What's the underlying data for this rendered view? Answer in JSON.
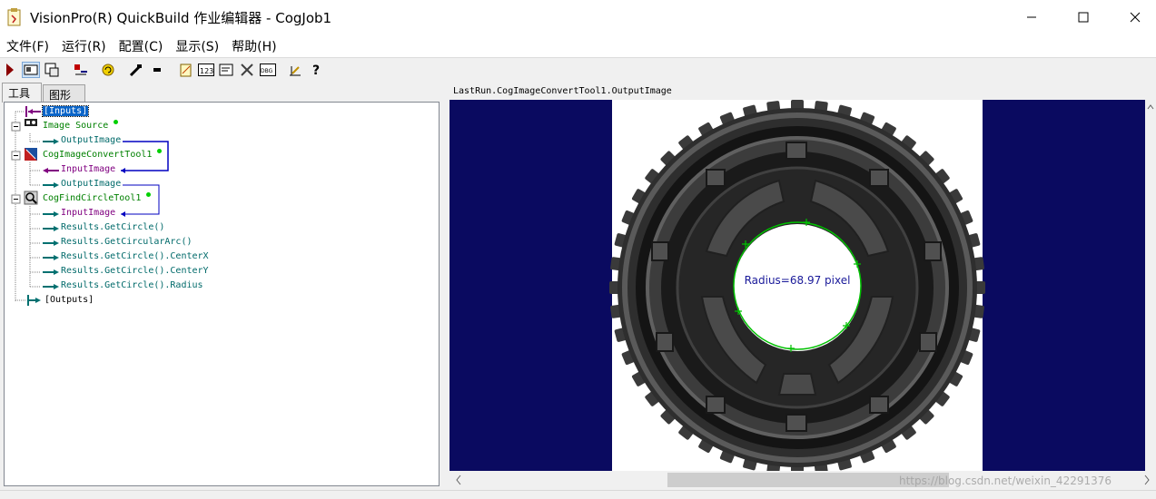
{
  "window": {
    "title": "VisionPro(R) QuickBuild 作业编辑器 - CogJob1",
    "minimize_icon": "minimize-icon",
    "maximize_icon": "maximize-icon",
    "close_icon": "close-icon"
  },
  "menu": {
    "items": [
      "文件(F)",
      "运行(R)",
      "配置(C)",
      "显示(S)",
      "帮助(H)"
    ]
  },
  "toolbar": {
    "icons": [
      "run-icon",
      "image-view-icon",
      "save-icon",
      "add-input-icon",
      "refresh-icon",
      "tool-icon",
      "small-tool-icon",
      "edit-icon",
      "number-icon",
      "display-icon",
      "tools-icon",
      "debug-icon",
      "measure-icon",
      "help-icon"
    ]
  },
  "left_panel": {
    "tabs": [
      "工具",
      "图形"
    ],
    "tree": {
      "inputs": "[Inputs]",
      "image_source": "Image Source",
      "image_source_output": "OutputImage",
      "convert_tool": "CogImageConvertTool1",
      "convert_input": "InputImage",
      "convert_output": "OutputImage",
      "find_circle_tool": "CogFindCircleTool1",
      "find_circle_input": "InputImage",
      "results": [
        "Results.GetCircle()",
        "Results.GetCircularArc()",
        "Results.GetCircle().CenterX",
        "Results.GetCircle().CenterY",
        "Results.GetCircle().Radius"
      ],
      "outputs": "[Outputs]"
    }
  },
  "image_view": {
    "header": "LastRun.CogImageConvertTool1.OutputImage",
    "annotation": "Radius=68.97 pixel",
    "background_color": "#0a0a60",
    "circle_color": "#00c000",
    "label_color": "#1a1a9a"
  },
  "watermark": "https://blog.csdn.net/weixin_42291376"
}
